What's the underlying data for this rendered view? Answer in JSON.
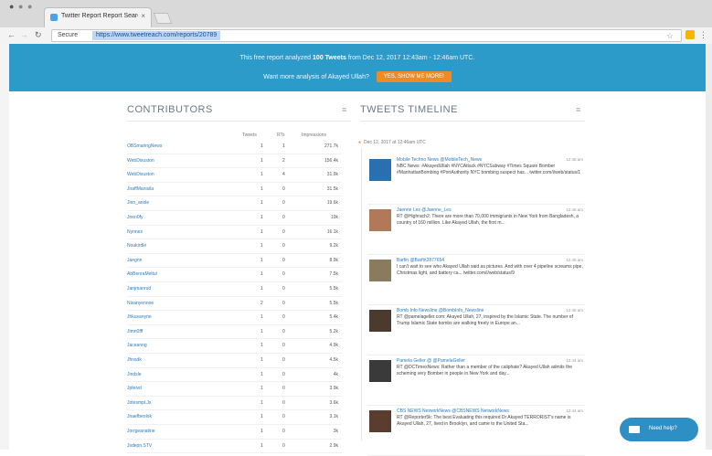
{
  "browser": {
    "tab_title": "Twitter Report Report Search",
    "tab_close": "×",
    "url_prefix": "Secure",
    "url": "https://www.tweetreach.com/reports/20789"
  },
  "banner": {
    "line1_pre": "This free report analyzed",
    "line1_bold": "100 Tweets",
    "line1_post": "from Dec 12, 2017 12:43am - 12:46am UTC.",
    "line2": "Want more analysis of Akayed Ullah?",
    "cta": "YES, SHOW ME MORE!"
  },
  "contributors": {
    "title": "CONTRIBUTORS",
    "columns": [
      "Tweets",
      "RTs",
      "Impressions"
    ],
    "rows": [
      {
        "user": "OBSmaringNews",
        "tweets": "1",
        "rts": "1",
        "imp": "271.7k"
      },
      {
        "user": "WebDisuston",
        "tweets": "1",
        "rts": "2",
        "imp": "156.4k"
      },
      {
        "user": "WebDisuston",
        "tweets": "1",
        "rts": "4",
        "imp": "31.9k"
      },
      {
        "user": "JiraffManisila",
        "tweets": "1",
        "rts": "0",
        "imp": "31.5k"
      },
      {
        "user": "Jinn_anole",
        "tweets": "1",
        "rts": "0",
        "imp": "19.6k"
      },
      {
        "user": "Jnen0fy",
        "tweets": "1",
        "rts": "0",
        "imp": "19k"
      },
      {
        "user": "Nynnes",
        "tweets": "1",
        "rts": "0",
        "imp": "16.1k"
      },
      {
        "user": "Noukirdle",
        "tweets": "1",
        "rts": "0",
        "imp": "9.2k"
      },
      {
        "user": "Jaegnn",
        "tweets": "1",
        "rts": "0",
        "imp": "8.9k"
      },
      {
        "user": "AbBenraMeltul",
        "tweets": "1",
        "rts": "0",
        "imp": "7.5k"
      },
      {
        "user": "Janjmanrud",
        "tweets": "1",
        "rts": "0",
        "imp": "5.5k"
      },
      {
        "user": "Nixanyennoe",
        "tweets": "2",
        "rts": "0",
        "imp": "5.5k"
      },
      {
        "user": "Jhkusanyne",
        "tweets": "1",
        "rts": "0",
        "imp": "5.4k"
      },
      {
        "user": "Jimn0fff",
        "tweets": "1",
        "rts": "0",
        "imp": "5.2k"
      },
      {
        "user": "Jaceanng",
        "tweets": "1",
        "rts": "0",
        "imp": "4.9k"
      },
      {
        "user": "Jhnsdk",
        "tweets": "1",
        "rts": "0",
        "imp": "4.5k"
      },
      {
        "user": "Jindsle",
        "tweets": "1",
        "rts": "0",
        "imp": "4k"
      },
      {
        "user": "Jpfeivd",
        "tweets": "1",
        "rts": "0",
        "imp": "3.9k"
      },
      {
        "user": "Jotesmpl.Js",
        "tweets": "1",
        "rts": "0",
        "imp": "3.6k"
      },
      {
        "user": "Jnaefbeolok",
        "tweets": "1",
        "rts": "0",
        "imp": "3.1k"
      },
      {
        "user": "Jorrgeanatine",
        "tweets": "1",
        "rts": "0",
        "imp": "3k"
      },
      {
        "user": "Jsdepn.STV",
        "tweets": "1",
        "rts": "0",
        "imp": "2.9k"
      }
    ]
  },
  "timeline": {
    "title": "TWEETS TIMELINE",
    "date": "Dec 12, 2017 at 12:46am UTC",
    "tweets": [
      {
        "name": "Mobile Techno News @MobileTech_News",
        "time": "12:46 am",
        "text": "NBC News: #AkayedUllah #NYCAttack #NYCSubway #Times Square Bomber #ManhattanBombing #PortAuthority NYC bombing suspect has... twitter.com/i/web/status/1",
        "color": "#2a6fb0"
      },
      {
        "name": "Jaenne Les @Jaenne_Les",
        "time": "12:46 am",
        "text": "RT @Highrach2: There are more than 70,000 immigrants in New York from Bangladesh, a country of 160 million. Like Akayed Ullah, the first m...",
        "color": "#b07a58"
      },
      {
        "name": "Barfin @Barfin2877654",
        "time": "12:45 am",
        "text": "I can't wait to see who Akayed Ullah said as pictures. And with over 4 pipeline screams pipe, Christmas light, and battery ca... twitter.com/i/web/status/9",
        "color": "#8a7a5e"
      },
      {
        "name": "Bomb Info Newsline @BombInfo_Newsline",
        "time": "12:45 am",
        "text": "RT @pamelageller.com: Akayed Ullah, 27, inspired by the Islamic State. The number of Trump Islamic State bombs are walking freely in Europe an...",
        "color": "#4b3a2f"
      },
      {
        "name": "Pamela Geller @ @PamelaGeller",
        "time": "12:44 am",
        "text": "RT @DCTimesNews: Rather than a member of the caliphate? Akayed Ullah admits the scheming very Bomber in people in New York and day...",
        "color": "#3a3a3a"
      },
      {
        "name": "CBS NEWS NetworkNews @CBSNEWS NetworkNews",
        "time": "12:44 am",
        "text": "RT @Reporter5k: The best Evaluating this required Dr Akayed TERRORIST's name is Akayed Ullah, 27, lived in Brooklyn, and came to the United Sta...",
        "color": "#5b3d30"
      }
    ]
  },
  "help": {
    "label": "Need help?"
  }
}
